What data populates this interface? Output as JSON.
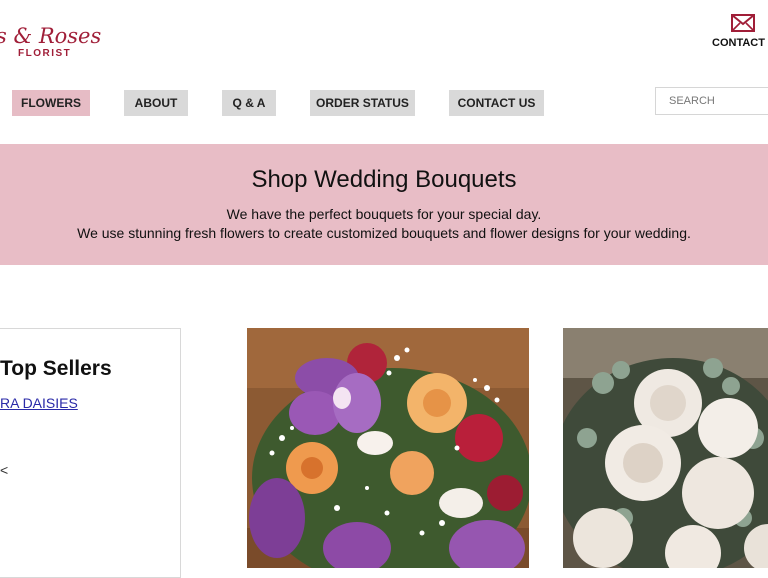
{
  "brand": {
    "logo_script": "s & Roses",
    "logo_sub": "FLORIST"
  },
  "header": {
    "contact_label": "CONTACT US",
    "contact_icon": "envelope-icon"
  },
  "nav": {
    "items": [
      {
        "label": "FLOWERS",
        "active": true
      },
      {
        "label": "ABOUT"
      },
      {
        "label": "Q & A"
      },
      {
        "label": "ORDER STATUS"
      },
      {
        "label": "CONTACT US"
      }
    ]
  },
  "search": {
    "placeholder": "SEARCH",
    "value": ""
  },
  "hero": {
    "title": "Shop Wedding Bouquets",
    "line1": "We have the perfect bouquets for your special day.",
    "line2": "We use stunning fresh flowers to create customized bouquets and flower designs for your wedding."
  },
  "top_sellers": {
    "title": "Top Sellers",
    "link": "RA DAISIES",
    "extra": "<"
  },
  "colors": {
    "accent": "#a01e38",
    "nav_active": "#e6bcc5",
    "nav_default": "#d9d9d9",
    "hero_bg": "#e8bdc6",
    "link": "#2a2aa8"
  }
}
